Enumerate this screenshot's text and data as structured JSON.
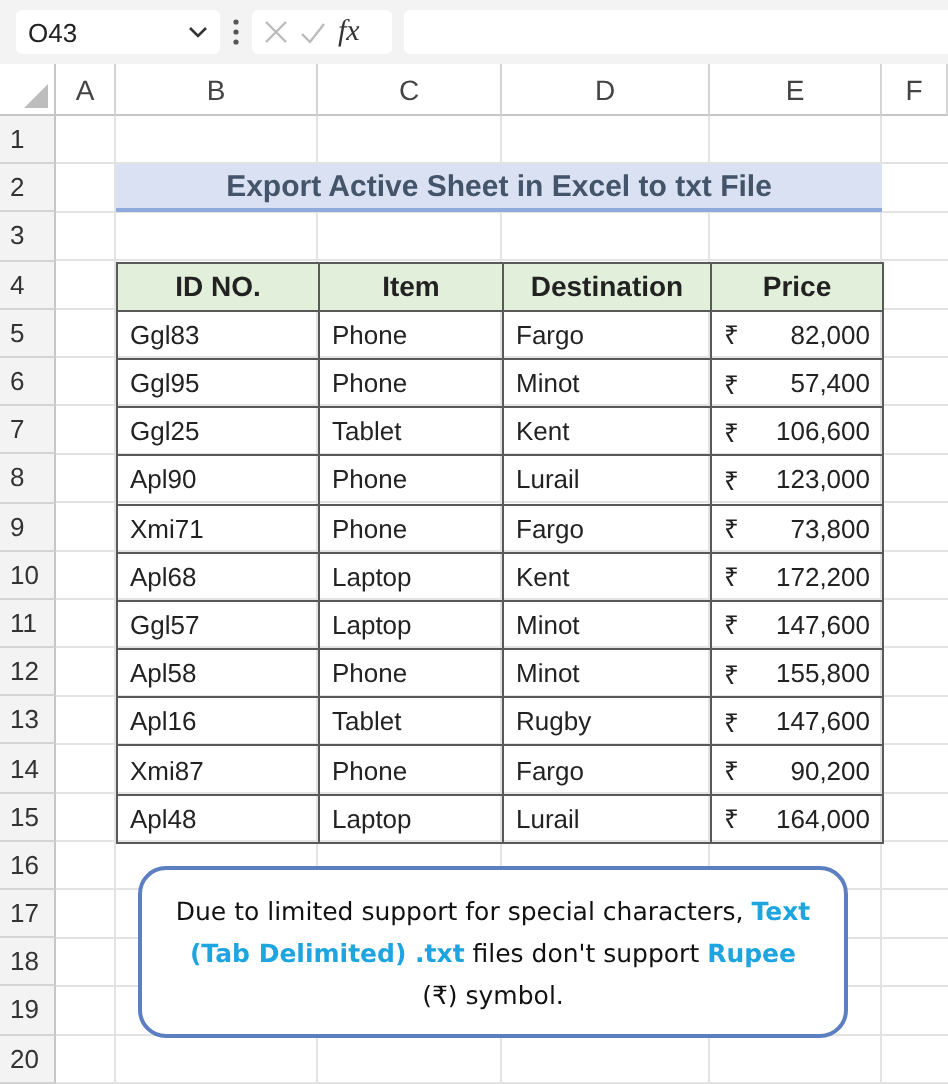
{
  "formula_bar": {
    "name_box": "O43",
    "function_label": "fx"
  },
  "columns": [
    "A",
    "B",
    "C",
    "D",
    "E",
    "F"
  ],
  "rows": [
    "1",
    "2",
    "3",
    "4",
    "5",
    "6",
    "7",
    "8",
    "9",
    "10",
    "11",
    "12",
    "13",
    "14",
    "15",
    "16",
    "17",
    "18",
    "19",
    "20"
  ],
  "title": "Export Active Sheet in Excel to txt File",
  "table": {
    "columns": [
      "ID NO.",
      "Item",
      "Destination",
      "Price"
    ],
    "rows": [
      {
        "id": "Ggl83",
        "item": "Phone",
        "destination": "Fargo",
        "currency": "₹",
        "amount": "82,000"
      },
      {
        "id": "Ggl95",
        "item": "Phone",
        "destination": "Minot",
        "currency": "₹",
        "amount": "57,400"
      },
      {
        "id": "Ggl25",
        "item": "Tablet",
        "destination": "Kent",
        "currency": "₹",
        "amount": "106,600"
      },
      {
        "id": "Apl90",
        "item": "Phone",
        "destination": "Lurail",
        "currency": "₹",
        "amount": "123,000"
      },
      {
        "id": "Xmi71",
        "item": "Phone",
        "destination": "Fargo",
        "currency": "₹",
        "amount": "73,800"
      },
      {
        "id": "Apl68",
        "item": "Laptop",
        "destination": "Kent",
        "currency": "₹",
        "amount": "172,200"
      },
      {
        "id": "Ggl57",
        "item": "Laptop",
        "destination": "Minot",
        "currency": "₹",
        "amount": "147,600"
      },
      {
        "id": "Apl58",
        "item": "Phone",
        "destination": "Minot",
        "currency": "₹",
        "amount": "155,800"
      },
      {
        "id": "Apl16",
        "item": "Tablet",
        "destination": "Rugby",
        "currency": "₹",
        "amount": "147,600"
      },
      {
        "id": "Xmi87",
        "item": "Phone",
        "destination": "Fargo",
        "currency": "₹",
        "amount": "90,200"
      },
      {
        "id": "Apl48",
        "item": "Laptop",
        "destination": "Lurail",
        "currency": "₹",
        "amount": "164,000"
      }
    ]
  },
  "note": [
    {
      "text": "Due to limited support for special characters, ",
      "highlight": false
    },
    {
      "text": "Text (Tab Delimited) .txt",
      "highlight": true
    },
    {
      "text": " files don't support ",
      "highlight": false
    },
    {
      "text": "Rupee",
      "highlight": true
    },
    {
      "text": " (₹) symbol.",
      "highlight": false
    }
  ]
}
